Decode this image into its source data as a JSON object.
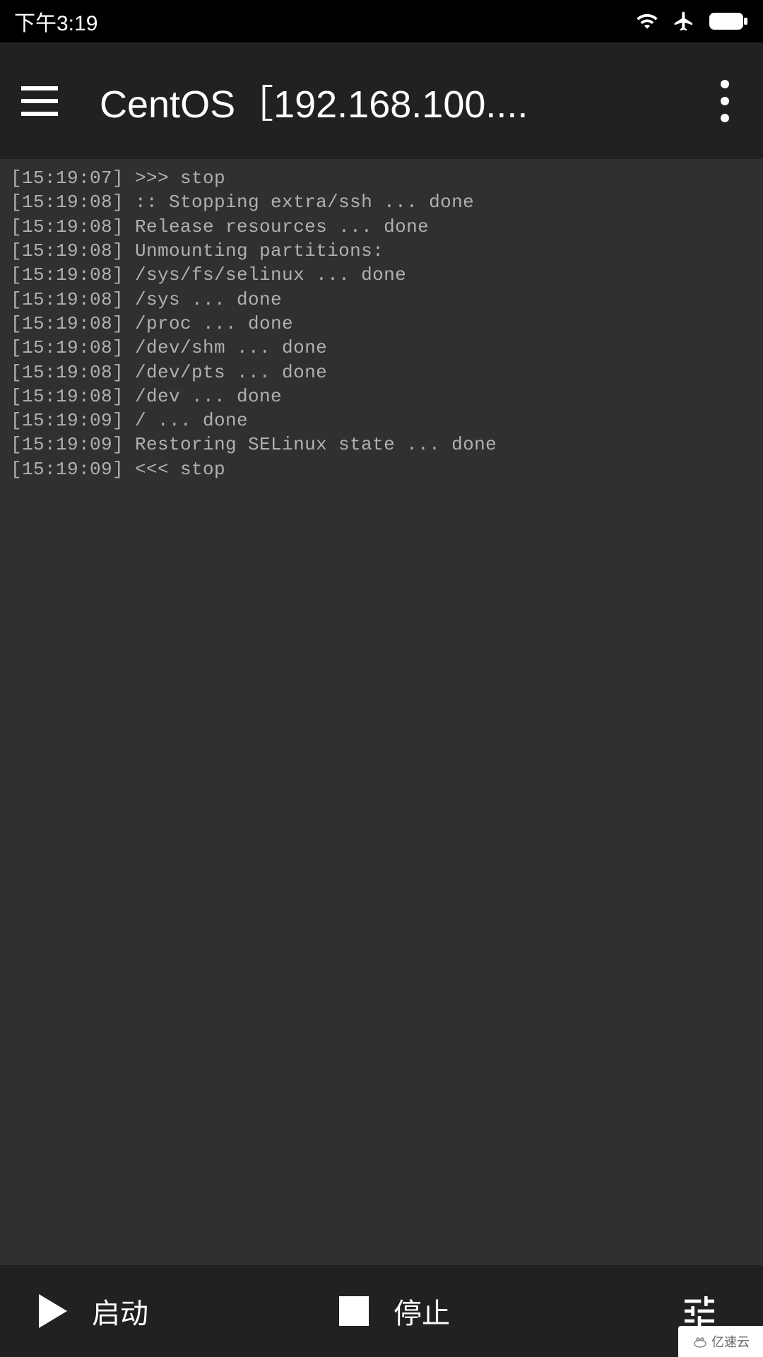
{
  "status_bar": {
    "time": "下午3:19"
  },
  "app_bar": {
    "title": "CentOS［192.168.100...."
  },
  "terminal": {
    "lines": [
      "[15:19:07] >>> stop",
      "[15:19:08] :: Stopping extra/ssh ... done",
      "[15:19:08] Release resources ... done",
      "[15:19:08] Unmounting partitions:",
      "[15:19:08] /sys/fs/selinux ... done",
      "[15:19:08] /sys ... done",
      "[15:19:08] /proc ... done",
      "[15:19:08] /dev/shm ... done",
      "[15:19:08] /dev/pts ... done",
      "[15:19:08] /dev ... done",
      "[15:19:09] / ... done",
      "[15:19:09] Restoring SELinux state ... done",
      "[15:19:09] <<< stop"
    ]
  },
  "bottom_bar": {
    "start_label": "启动",
    "stop_label": "停止"
  },
  "watermark": {
    "text": "亿速云"
  }
}
